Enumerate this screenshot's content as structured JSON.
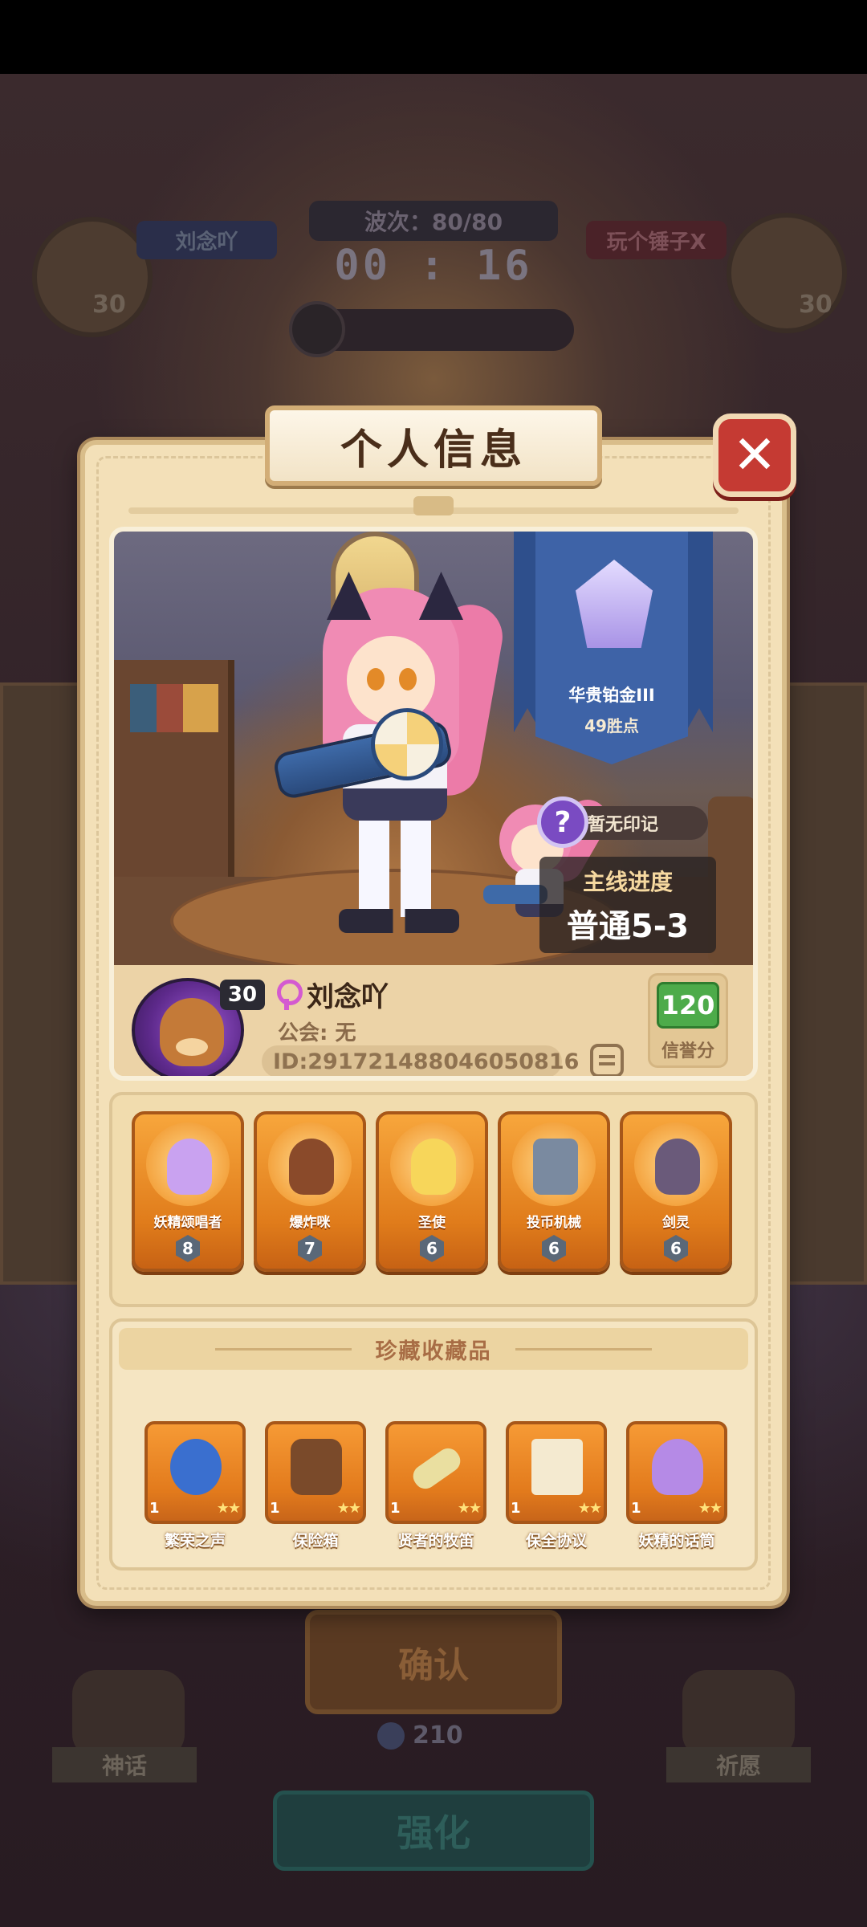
{
  "background": {
    "player_left_name": "刘念吖",
    "player_left_level": "30",
    "player_right_name": "玩个锤子X",
    "player_right_level": "30",
    "wave": "波次：80/80",
    "timer": "00 : 16",
    "confirm_label": "确认",
    "coin_amount": "210",
    "enhance_label": "强化",
    "bottom_left_label": "神话",
    "bottom_right_label": "祈愿"
  },
  "modal": {
    "title": "个人信息",
    "close_icon": "close-icon",
    "rank": {
      "name": "华贵铂金III",
      "points": "49胜点"
    },
    "mark_label": "暂无印记",
    "progress": {
      "title": "主线进度",
      "value": "普通5-3"
    },
    "profile": {
      "level": "30",
      "name": "刘念吖",
      "guild": "公会: 无",
      "id": "ID:291721488046050816",
      "credit_value": "120",
      "credit_label": "信誉分"
    },
    "heroes": [
      {
        "name": "妖精颂唱者",
        "level": "8",
        "color": "#c9a2f0"
      },
      {
        "name": "爆炸咪",
        "level": "7",
        "color": "#8a4a2a"
      },
      {
        "name": "圣使",
        "level": "6",
        "color": "#f7d65a"
      },
      {
        "name": "投币机械",
        "level": "6",
        "color": "#7a8aa0"
      },
      {
        "name": "剑灵",
        "level": "6",
        "color": "#6a5a7a"
      }
    ],
    "collection": {
      "title": "珍藏收藏品",
      "items": [
        {
          "name": "繁荣之声",
          "count": "1",
          "stars": "★★",
          "color": "#3a6fcf"
        },
        {
          "name": "保险箱",
          "count": "1",
          "stars": "★★",
          "color": "#7a4a2a"
        },
        {
          "name": "贤者的牧笛",
          "count": "1",
          "stars": "★★",
          "color": "#eadfa0"
        },
        {
          "name": "保全协议",
          "count": "1",
          "stars": "★★",
          "color": "#f4ead0"
        },
        {
          "name": "妖精的话筒",
          "count": "1",
          "stars": "★★",
          "color": "#b58ae6"
        }
      ]
    }
  }
}
